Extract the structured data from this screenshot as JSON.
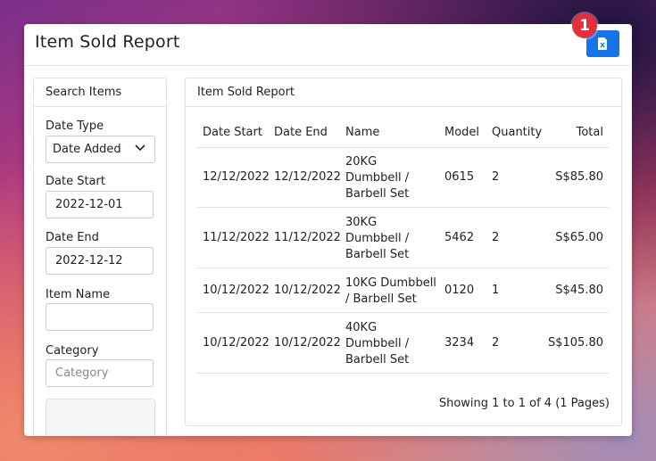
{
  "header": {
    "title": "Item Sold Report",
    "export_icon": "excel-file-icon",
    "badge": "1",
    "accent_color": "#1575e8",
    "badge_color": "#e82d3b"
  },
  "search": {
    "title": "Search Items",
    "date_type_label": "Date Type",
    "date_type_value": "Date Added",
    "date_start_label": "Date Start",
    "date_start_value": "2022-12-01",
    "date_end_label": "Date End",
    "date_end_value": "2022-12-12",
    "item_name_label": "Item Name",
    "item_name_value": "",
    "category_label": "Category",
    "category_placeholder": "Category"
  },
  "report": {
    "title": "Item Sold Report",
    "columns": [
      "Date Start",
      "Date End",
      "Name",
      "Model",
      "Quantity",
      "Total"
    ],
    "rows": [
      {
        "date_start": "12/12/2022",
        "date_end": "12/12/2022",
        "name": [
          "20KG",
          "Dumbbell /",
          "Barbell Set"
        ],
        "model": "0615",
        "quantity": "2",
        "total": "S$85.80"
      },
      {
        "date_start": "11/12/2022",
        "date_end": "11/12/2022",
        "name": [
          "30KG",
          "Dumbbell /",
          "Barbell Set"
        ],
        "model": "5462",
        "quantity": "2",
        "total": "S$65.00"
      },
      {
        "date_start": "10/12/2022",
        "date_end": "10/12/2022",
        "name": [
          "10KG Dumbbell",
          "/ Barbell Set"
        ],
        "model": "0120",
        "quantity": "1",
        "total": "S$45.80"
      },
      {
        "date_start": "10/12/2022",
        "date_end": "10/12/2022",
        "name": [
          "40KG",
          "Dumbbell /",
          "Barbell Set"
        ],
        "model": "3234",
        "quantity": "2",
        "total": "S$105.80"
      }
    ],
    "footer": "Showing 1 to 1 of 4 (1 Pages)"
  }
}
